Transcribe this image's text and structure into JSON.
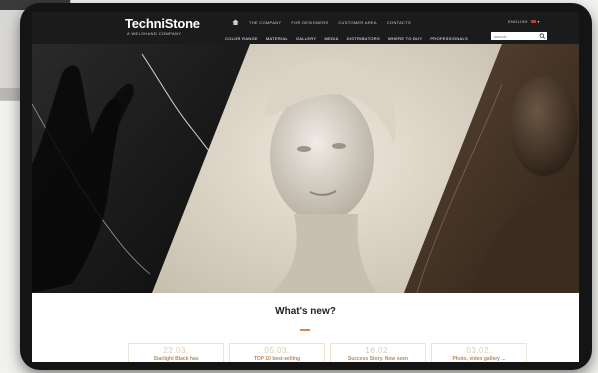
{
  "brand": {
    "name": "TechniStone",
    "tagline": "A WELSHAND COMPANY"
  },
  "top_nav": [
    "THE COMPANY",
    "FOR DESIGNERS",
    "CUSTOMER AREA",
    "CONTACTS"
  ],
  "language": "ENGLISH",
  "main_nav": [
    "COLOR RANGE",
    "MATERIAL",
    "GALLERY",
    "MEDIA",
    "DISTRIBUTORS",
    "WHERE TO BUY",
    "PROFESSIONALS"
  ],
  "search": {
    "placeholder": "search..."
  },
  "news": {
    "title": "What's new?",
    "items": [
      {
        "date": "22.03.",
        "title": "Starlight Black has"
      },
      {
        "date": "05.03.",
        "title": "TOP 10 best-selling"
      },
      {
        "date": "16.02.",
        "title": "Success Story. Now seen"
      },
      {
        "date": "03.02.",
        "title": "Photo, video gallery ..."
      }
    ]
  },
  "colors": {
    "accent": "#d5894b",
    "header_bg": "#1b1b1b",
    "date_color": "#e4c9a8"
  }
}
